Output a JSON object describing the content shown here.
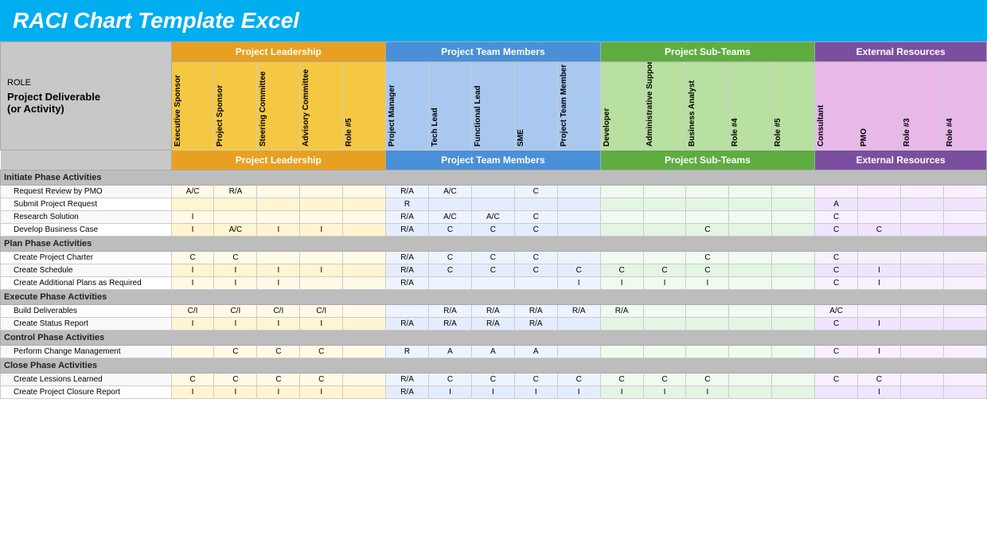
{
  "title": "RACI Chart Template Excel",
  "role_label": "ROLE",
  "deliverable_label": "Project Deliverable\n(or Activity)",
  "groups": [
    {
      "id": "leadership",
      "label": "Project Leadership",
      "class": "group-leadership",
      "span": 5,
      "band": "band-leadership"
    },
    {
      "id": "team",
      "label": "Project Team Members",
      "class": "group-team",
      "span": 5,
      "band": "band-team"
    },
    {
      "id": "subteams",
      "label": "Project Sub-Teams",
      "class": "group-subteams",
      "span": 5,
      "band": "band-subteams"
    },
    {
      "id": "external",
      "label": "External Resources",
      "class": "group-external",
      "span": 4,
      "band": "band-external"
    }
  ],
  "columns": [
    {
      "id": "exec-sponsor",
      "label": "Executive Sponsor",
      "group": "leadership",
      "band": "band-leadership"
    },
    {
      "id": "proj-sponsor",
      "label": "Project Sponsor",
      "group": "leadership",
      "band": "band-leadership"
    },
    {
      "id": "steering",
      "label": "Steering Committee",
      "group": "leadership",
      "band": "band-leadership"
    },
    {
      "id": "advisory",
      "label": "Advisory Committee",
      "group": "leadership",
      "band": "band-leadership"
    },
    {
      "id": "role5",
      "label": "Role #5",
      "group": "leadership",
      "band": "band-leadership"
    },
    {
      "id": "proj-mgr",
      "label": "Project Manager",
      "group": "team",
      "band": "band-team"
    },
    {
      "id": "tech-lead",
      "label": "Tech Lead",
      "group": "team",
      "band": "band-team"
    },
    {
      "id": "func-lead",
      "label": "Functional Lead",
      "group": "team",
      "band": "band-team"
    },
    {
      "id": "sme",
      "label": "SME",
      "group": "team",
      "band": "band-team"
    },
    {
      "id": "ptm",
      "label": "Project Team Member",
      "group": "team",
      "band": "band-team"
    },
    {
      "id": "developer",
      "label": "Developer",
      "group": "subteams",
      "band": "band-subteams"
    },
    {
      "id": "admin-support",
      "label": "Administrative Support",
      "group": "subteams",
      "band": "band-subteams"
    },
    {
      "id": "biz-analyst",
      "label": "Business Analyst",
      "group": "subteams",
      "band": "band-subteams"
    },
    {
      "id": "role4a",
      "label": "Role #4",
      "group": "subteams",
      "band": "band-subteams"
    },
    {
      "id": "role5a",
      "label": "Role #5",
      "group": "subteams",
      "band": "band-subteams"
    },
    {
      "id": "consultant",
      "label": "Consultant",
      "group": "external",
      "band": "band-external"
    },
    {
      "id": "pmo",
      "label": "PMO",
      "group": "external",
      "band": "band-external"
    },
    {
      "id": "role3",
      "label": "Role #3",
      "group": "external",
      "band": "band-external"
    },
    {
      "id": "role4b",
      "label": "Role #4",
      "group": "external",
      "band": "band-external"
    }
  ],
  "sections": [
    {
      "id": "initiate",
      "label": "Initiate Phase Activities",
      "rows": [
        {
          "activity": "Request Review by PMO",
          "cells": [
            "A/C",
            "R/A",
            "",
            "",
            "",
            "R/A",
            "A/C",
            "",
            "C",
            "",
            "",
            "",
            "",
            "",
            "",
            "",
            "",
            "",
            ""
          ]
        },
        {
          "activity": "Submit Project Request",
          "cells": [
            "",
            "",
            "",
            "",
            "",
            "R",
            "",
            "",
            "",
            "",
            "",
            "",
            "",
            "",
            "",
            "A",
            "",
            "",
            ""
          ]
        },
        {
          "activity": "Research Solution",
          "cells": [
            "I",
            "",
            "",
            "",
            "",
            "R/A",
            "A/C",
            "A/C",
            "C",
            "",
            "",
            "",
            "",
            "",
            "",
            "C",
            "",
            "",
            ""
          ]
        },
        {
          "activity": "Develop Business Case",
          "cells": [
            "I",
            "A/C",
            "I",
            "I",
            "",
            "R/A",
            "C",
            "C",
            "C",
            "",
            "",
            "",
            "C",
            "",
            "",
            "C",
            "C",
            "",
            ""
          ]
        }
      ]
    },
    {
      "id": "plan",
      "label": "Plan Phase Activities",
      "rows": [
        {
          "activity": "Create Project Charter",
          "cells": [
            "C",
            "C",
            "",
            "",
            "",
            "R/A",
            "C",
            "C",
            "C",
            "",
            "",
            "",
            "C",
            "",
            "",
            "C",
            "",
            "",
            ""
          ]
        },
        {
          "activity": "Create Schedule",
          "cells": [
            "I",
            "I",
            "I",
            "I",
            "",
            "R/A",
            "C",
            "C",
            "C",
            "C",
            "C",
            "C",
            "C",
            "",
            "",
            "C",
            "I",
            "",
            ""
          ]
        },
        {
          "activity": "Create Additional Plans as Required",
          "cells": [
            "I",
            "I",
            "I",
            "",
            "",
            "R/A",
            "",
            "",
            "",
            "I",
            "I",
            "I",
            "I",
            "",
            "",
            "C",
            "I",
            "",
            ""
          ]
        }
      ]
    },
    {
      "id": "execute",
      "label": "Execute Phase Activities",
      "rows": [
        {
          "activity": "Build Deliverables",
          "cells": [
            "C/I",
            "C/I",
            "C/I",
            "C/I",
            "",
            "",
            "R/A",
            "R/A",
            "R/A",
            "R/A",
            "R/A",
            "",
            "",
            "",
            "",
            "A/C",
            "",
            "",
            ""
          ]
        },
        {
          "activity": "Create Status Report",
          "cells": [
            "I",
            "I",
            "I",
            "I",
            "",
            "R/A",
            "R/A",
            "R/A",
            "R/A",
            "",
            "",
            "",
            "",
            "",
            "",
            "C",
            "I",
            "",
            ""
          ]
        }
      ]
    },
    {
      "id": "control",
      "label": "Control Phase Activities",
      "rows": [
        {
          "activity": "Perform Change Management",
          "cells": [
            "",
            "C",
            "C",
            "C",
            "",
            "R",
            "A",
            "A",
            "A",
            "",
            "",
            "",
            "",
            "",
            "",
            "C",
            "I",
            "",
            ""
          ]
        }
      ]
    },
    {
      "id": "close",
      "label": "Close Phase Activities",
      "rows": [
        {
          "activity": "Create Lessions Learned",
          "cells": [
            "C",
            "C",
            "C",
            "C",
            "",
            "R/A",
            "C",
            "C",
            "C",
            "C",
            "C",
            "C",
            "C",
            "",
            "",
            "C",
            "C",
            "",
            ""
          ]
        },
        {
          "activity": "Create Project Closure Report",
          "cells": [
            "I",
            "I",
            "I",
            "I",
            "",
            "R/A",
            "I",
            "I",
            "I",
            "I",
            "I",
            "I",
            "I",
            "",
            "",
            "",
            "I",
            "",
            ""
          ]
        }
      ]
    }
  ],
  "colors": {
    "title_bg": "#00AEEF",
    "leadership_bg": "#E8A020",
    "team_bg": "#4A90D9",
    "subteams_bg": "#5FAD41",
    "external_bg": "#7B4FA0",
    "section_bg": "#B0B0B0",
    "header_band_leadership": "#F5C842",
    "header_band_team": "#A8C8F0",
    "header_band_subteams": "#B8E0A0",
    "header_band_external": "#E8B8E8"
  }
}
